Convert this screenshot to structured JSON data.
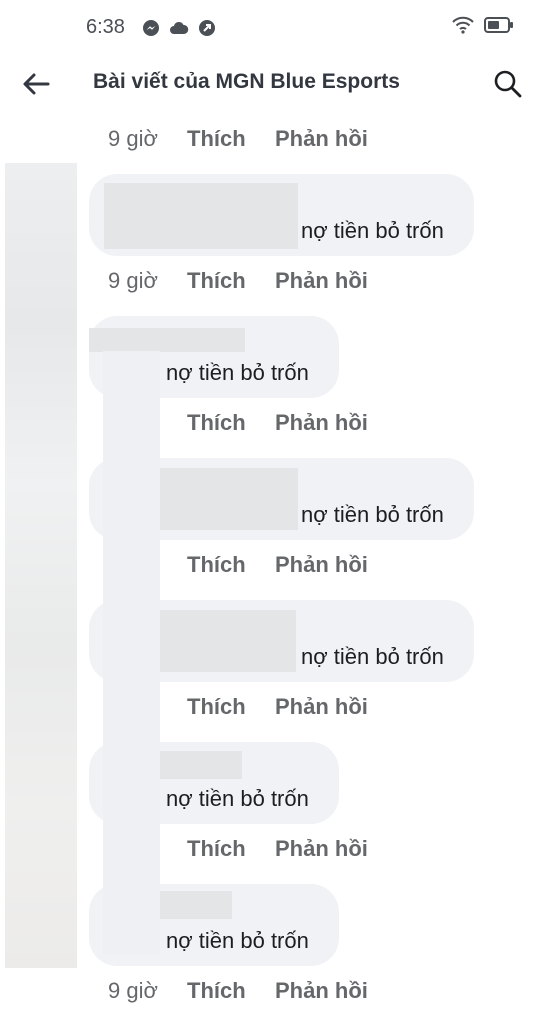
{
  "status_bar": {
    "time": "6:38",
    "left_icons": [
      "messenger-icon",
      "cloud-icon",
      "app-icon"
    ],
    "right_icons": [
      "wifi-icon",
      "battery-icon"
    ]
  },
  "header": {
    "title": "Bài viết của MGN Blue Esports",
    "back_icon": "back-arrow-icon",
    "search_icon": "search-icon"
  },
  "actions": {
    "like": "Thích",
    "reply": "Phản hồi"
  },
  "top_action_row": {
    "time": "9 giờ"
  },
  "comments": [
    {
      "text": "nợ tiền bỏ trốn",
      "time": "9 giờ"
    },
    {
      "text": "nợ tiền bỏ trốn",
      "time": ""
    },
    {
      "text": "nợ tiền bỏ trốn",
      "time": ""
    },
    {
      "text": "nợ tiền bỏ trốn",
      "time": ""
    },
    {
      "text": "nợ tiền bỏ trốn",
      "time": ""
    },
    {
      "text": "nợ tiền bỏ trốn",
      "time": "9 giờ"
    }
  ],
  "colors": {
    "bubble": "#f0f2f5",
    "action_text": "#65676b",
    "title_text": "#333840"
  }
}
